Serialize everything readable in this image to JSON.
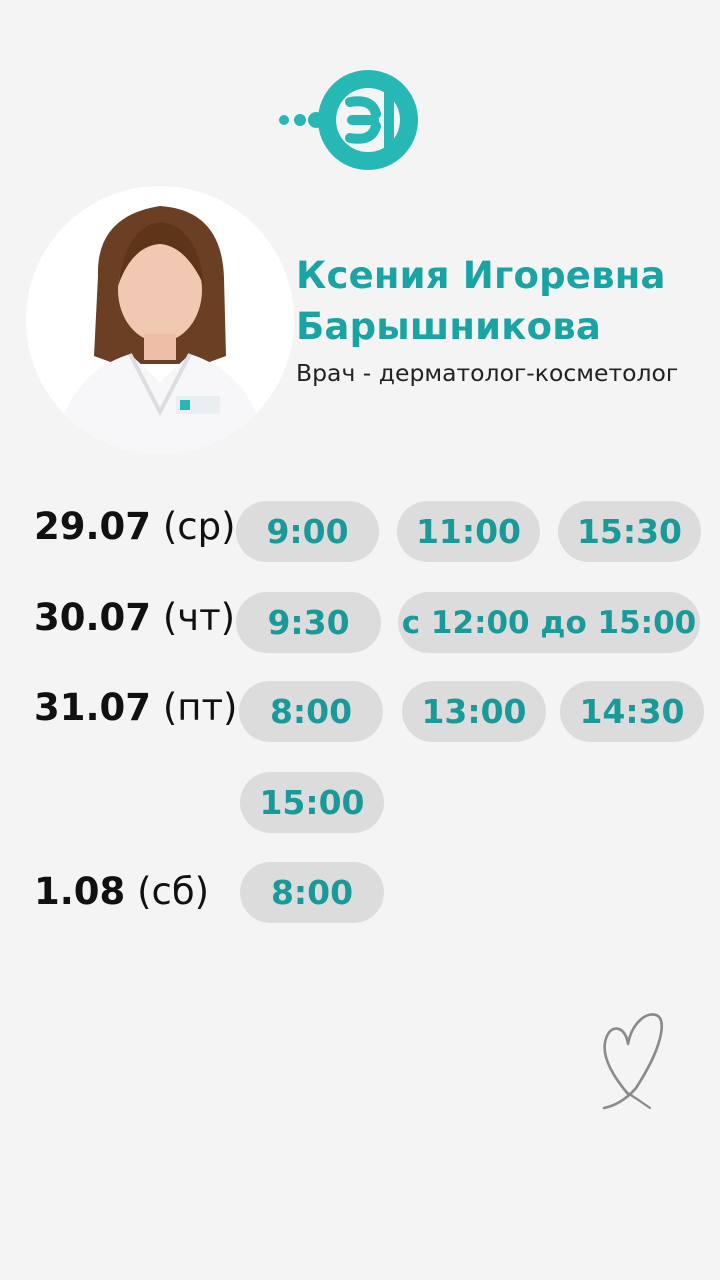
{
  "brand": {
    "logo_icon": "clinic-logo-icon",
    "color": "#27b8b5"
  },
  "doctor": {
    "name_line1": "Ксения Игоревна",
    "name_line2": "Барышникова",
    "role": "Врач - дерматолог-косметолог",
    "photo_icon": "doctor-photo"
  },
  "accent_color": "#1aa3a3",
  "schedule": [
    {
      "date": "29.07",
      "weekday": "(ср)",
      "slots": [
        "9:00",
        "11:00",
        "15:30"
      ]
    },
    {
      "date": "30.07",
      "weekday": "(чт)",
      "slots": [
        "9:30",
        "с 12:00 до 15:00"
      ]
    },
    {
      "date": "31.07",
      "weekday": "(пт)",
      "slots": [
        "8:00",
        "13:00",
        "14:30",
        "15:00"
      ]
    },
    {
      "date": "1.08",
      "weekday": "(сб)",
      "slots": [
        "8:00"
      ]
    }
  ],
  "decor": {
    "heart_icon": "heart-doodle-icon"
  }
}
